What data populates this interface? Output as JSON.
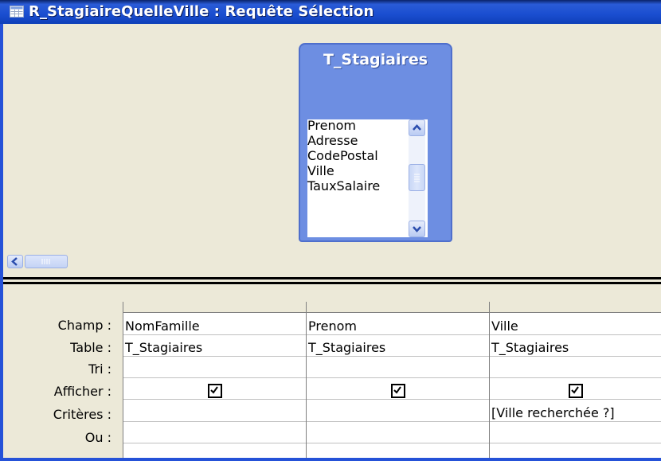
{
  "window": {
    "title": "R_StagiaireQuelleVille : Requête Sélection",
    "title_color": "#ffffff",
    "titlebar_color": "#1a4ed0"
  },
  "field_list": {
    "title": "T_Stagiaires",
    "items": [
      {
        "label": "Prenom"
      },
      {
        "label": "Adresse"
      },
      {
        "label": "CodePostal"
      },
      {
        "label": "Ville",
        "selected": true
      },
      {
        "label": "TauxSalaire"
      }
    ],
    "selected_color": "#1d3f9e"
  },
  "grid": {
    "row_labels": {
      "champ": "Champ :",
      "table": "Table :",
      "tri": "Tri :",
      "afficher": "Afficher :",
      "criteres": "Critères :",
      "ou": "Ou :"
    },
    "columns": [
      {
        "champ": "NomFamille",
        "table": "T_Stagiaires",
        "tri": "",
        "afficher": true,
        "criteres": "",
        "ou": ""
      },
      {
        "champ": "Prenom",
        "table": "T_Stagiaires",
        "tri": "",
        "afficher": true,
        "criteres": "",
        "ou": ""
      },
      {
        "champ": "Ville",
        "table": "T_Stagiaires",
        "tri": "",
        "afficher": true,
        "criteres": "[Ville recherchée ?]",
        "ou": ""
      }
    ]
  }
}
